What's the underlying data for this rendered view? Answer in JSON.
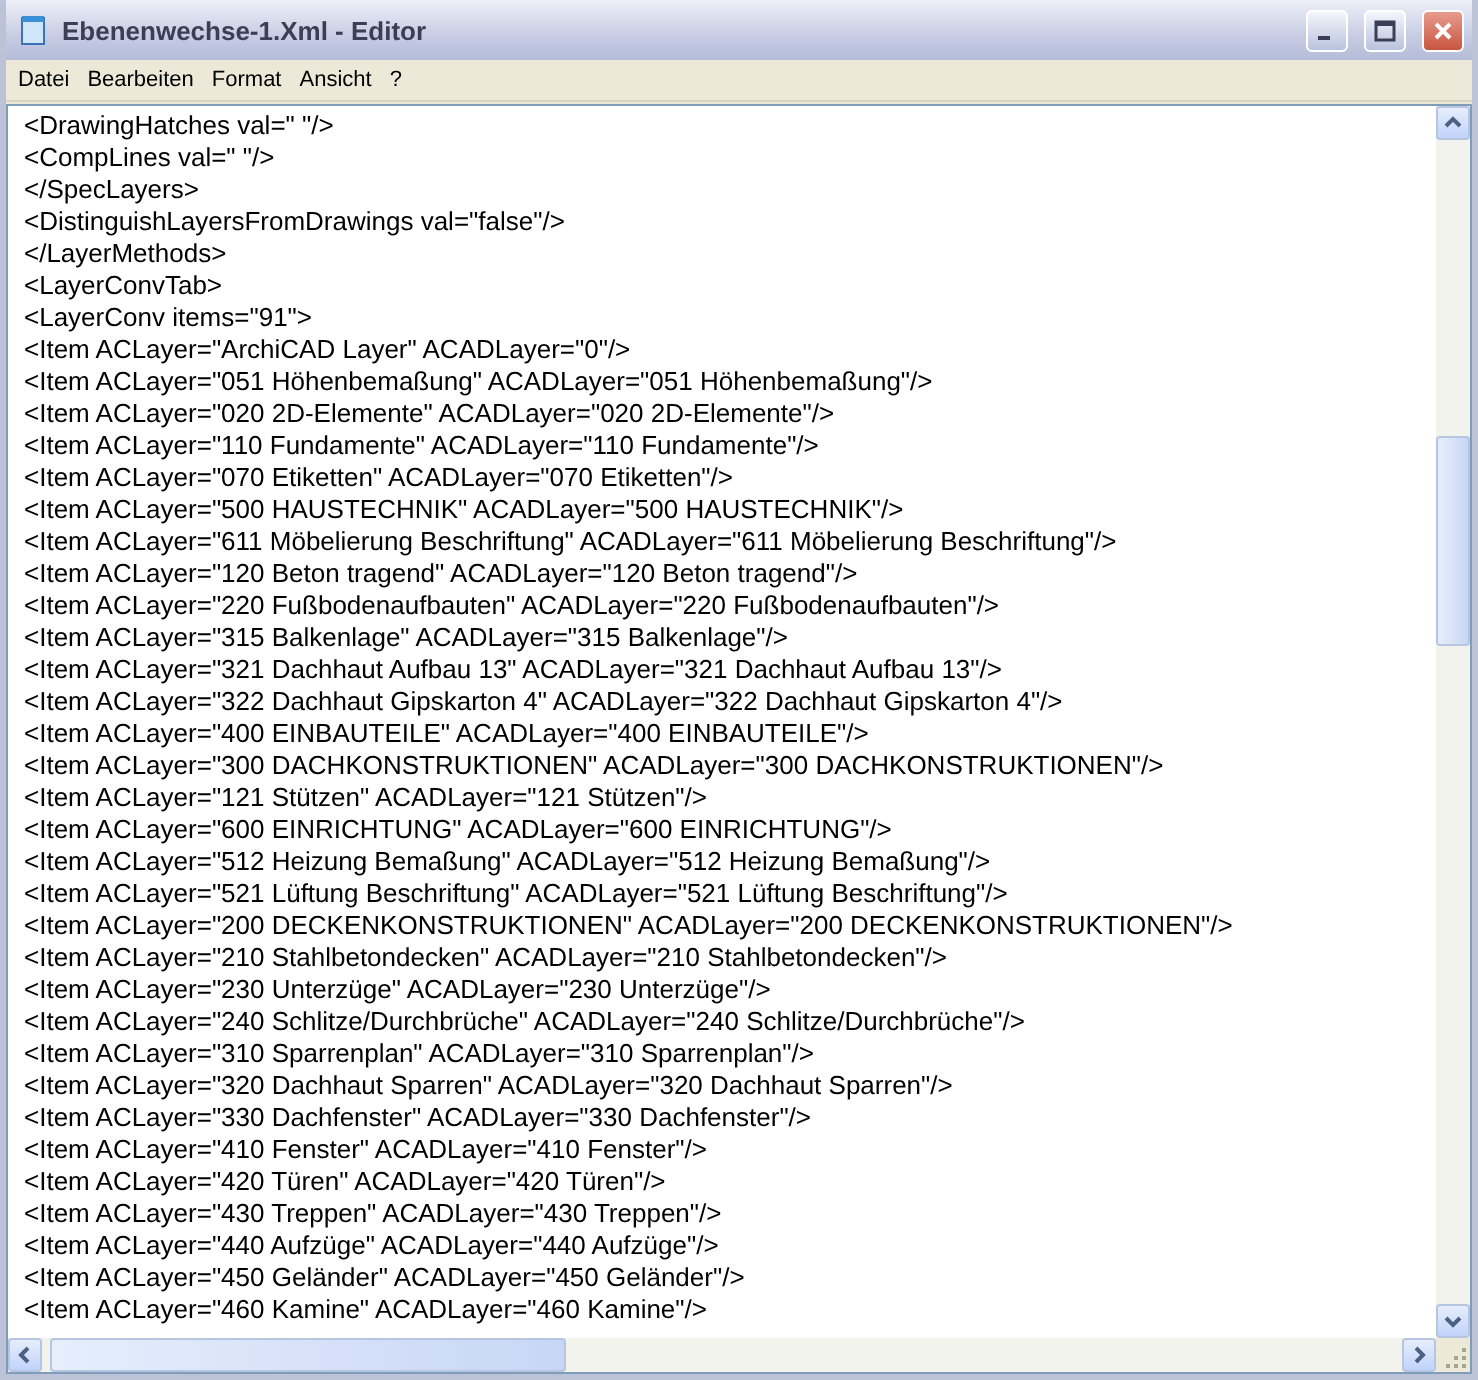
{
  "window": {
    "title": "Ebenenwechse-1.Xml - Editor"
  },
  "menu": [
    "Datei",
    "Bearbeiten",
    "Format",
    "Ansicht",
    "?"
  ],
  "lines": [
    "<DrawingHatches val=\" \"/>",
    "<CompLines val=\" \"/>",
    "</SpecLayers>",
    "<DistinguishLayersFromDrawings val=\"false\"/>",
    "</LayerMethods>",
    "<LayerConvTab>",
    "<LayerConv items=\"91\">",
    "<Item ACLayer=\"ArchiCAD Layer\" ACADLayer=\"0\"/>",
    "<Item ACLayer=\"051 Höhenbemaßung\" ACADLayer=\"051 Höhenbemaßung\"/>",
    "<Item ACLayer=\"020 2D-Elemente\" ACADLayer=\"020 2D-Elemente\"/>",
    "<Item ACLayer=\"110 Fundamente\" ACADLayer=\"110 Fundamente\"/>",
    "<Item ACLayer=\"070 Etiketten\" ACADLayer=\"070 Etiketten\"/>",
    "<Item ACLayer=\"500 HAUSTECHNIK\" ACADLayer=\"500 HAUSTECHNIK\"/>",
    "<Item ACLayer=\"611 Möbelierung Beschriftung\" ACADLayer=\"611 Möbelierung Beschriftung\"/>",
    "<Item ACLayer=\"120 Beton tragend\" ACADLayer=\"120 Beton tragend\"/>",
    "<Item ACLayer=\"220 Fußbodenaufbauten\" ACADLayer=\"220 Fußbodenaufbauten\"/>",
    "<Item ACLayer=\"315 Balkenlage\" ACADLayer=\"315 Balkenlage\"/>",
    "<Item ACLayer=\"321 Dachhaut Aufbau 13\" ACADLayer=\"321 Dachhaut Aufbau 13\"/>",
    "<Item ACLayer=\"322 Dachhaut Gipskarton 4\" ACADLayer=\"322 Dachhaut Gipskarton 4\"/>",
    "<Item ACLayer=\"400 EINBAUTEILE\" ACADLayer=\"400 EINBAUTEILE\"/>",
    "<Item ACLayer=\"300 DACHKONSTRUKTIONEN\" ACADLayer=\"300 DACHKONSTRUKTIONEN\"/>",
    "<Item ACLayer=\"121 Stützen\" ACADLayer=\"121 Stützen\"/>",
    "<Item ACLayer=\"600 EINRICHTUNG\" ACADLayer=\"600 EINRICHTUNG\"/>",
    "<Item ACLayer=\"512 Heizung Bemaßung\" ACADLayer=\"512 Heizung Bemaßung\"/>",
    "<Item ACLayer=\"521 Lüftung Beschriftung\" ACADLayer=\"521 Lüftung Beschriftung\"/>",
    "<Item ACLayer=\"200 DECKENKONSTRUKTIONEN\" ACADLayer=\"200 DECKENKONSTRUKTIONEN\"/>",
    "<Item ACLayer=\"210 Stahlbetondecken\" ACADLayer=\"210 Stahlbetondecken\"/>",
    "<Item ACLayer=\"230 Unterzüge\" ACADLayer=\"230 Unterzüge\"/>",
    "<Item ACLayer=\"240 Schlitze/Durchbrüche\" ACADLayer=\"240 Schlitze/Durchbrüche\"/>",
    "<Item ACLayer=\"310 Sparrenplan\" ACADLayer=\"310 Sparrenplan\"/>",
    "<Item ACLayer=\"320 Dachhaut Sparren\" ACADLayer=\"320 Dachhaut Sparren\"/>",
    "<Item ACLayer=\"330 Dachfenster\" ACADLayer=\"330 Dachfenster\"/>",
    "<Item ACLayer=\"410 Fenster\" ACADLayer=\"410 Fenster\"/>",
    "<Item ACLayer=\"420 Türen\" ACADLayer=\"420 Türen\"/>",
    "<Item ACLayer=\"430 Treppen\" ACADLayer=\"430 Treppen\"/>",
    "<Item ACLayer=\"440 Aufzüge\" ACADLayer=\"440 Aufzüge\"/>",
    "<Item ACLayer=\"450 Geländer\" ACADLayer=\"450 Geländer\"/>",
    "<Item ACLayer=\"460 Kamine\" ACADLayer=\"460 Kamine\"/>"
  ]
}
